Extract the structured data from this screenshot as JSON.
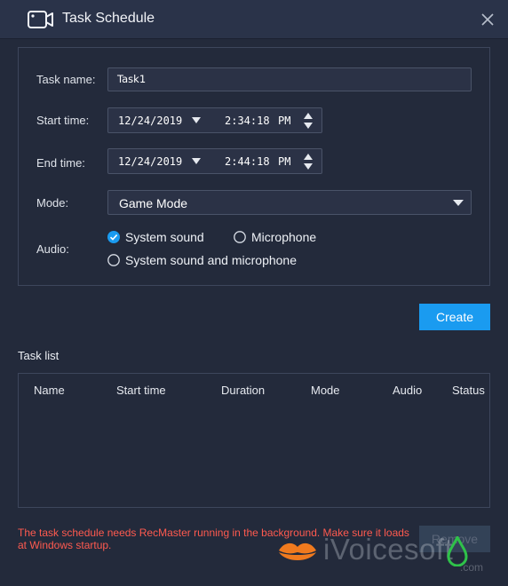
{
  "window": {
    "title": "Task Schedule"
  },
  "form": {
    "task_name_label": "Task name:",
    "task_name_value": "Task1",
    "start_time_label": "Start time:",
    "start_date": "12/24/2019",
    "start_time": "2:34:18",
    "start_ampm": "PM",
    "end_time_label": "End time:",
    "end_date": "12/24/2019",
    "end_time": "2:44:18",
    "end_ampm": "PM",
    "mode_label": "Mode:",
    "mode_value": "Game Mode",
    "audio_label": "Audio:",
    "audio_options": [
      {
        "label": "System sound",
        "selected": true
      },
      {
        "label": "Microphone",
        "selected": false
      },
      {
        "label": "System sound and microphone",
        "selected": false
      }
    ]
  },
  "buttons": {
    "create_label": "Create",
    "remove_label": "Remove"
  },
  "task_list": {
    "title": "Task list",
    "columns": [
      "Name",
      "Start time",
      "Duration",
      "Mode",
      "Audio",
      "Status"
    ],
    "rows": []
  },
  "footer": {
    "note": "The task schedule needs RecMaster running in the background. Make sure it loads at Windows startup."
  },
  "watermark": {
    "text": "iVoicesoft",
    "suffix": ".com"
  },
  "colors": {
    "background": "#232a3b",
    "titlebar": "#2a3349",
    "accent": "#1a9bf0",
    "warning_text": "#ff5a4f"
  },
  "icons": {
    "title": "camera-icon",
    "close": "close-icon",
    "date_dropdown": "caret-down-icon",
    "time_spinner": "spinner-icon",
    "mode_dropdown": "chevron-down-icon",
    "checked": "checkbox-checked-icon",
    "unchecked": "radio-empty-icon"
  }
}
